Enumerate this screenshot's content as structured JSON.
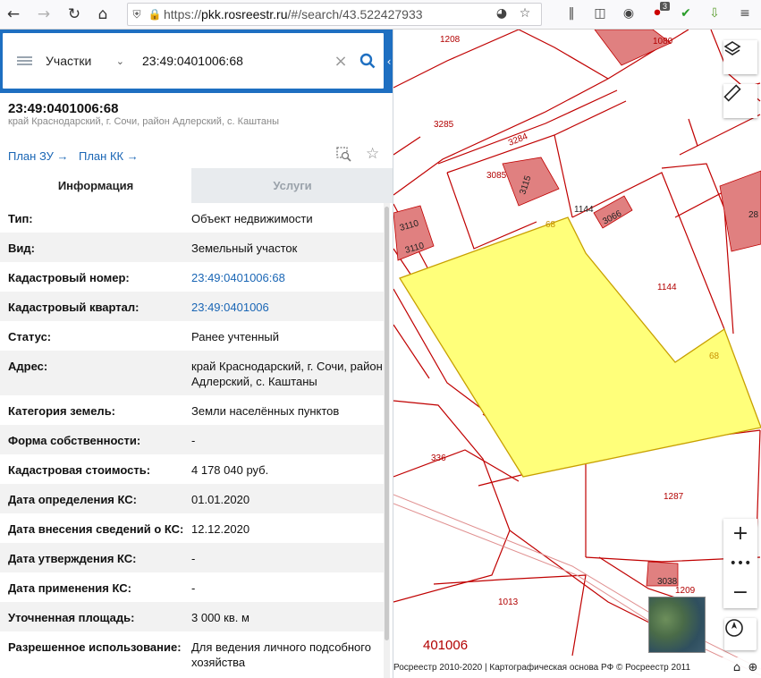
{
  "browser": {
    "url_scheme": "https://",
    "url_host": "pkk.rosreestr.ru",
    "url_path": "/#/search/43.522427933",
    "extension_badge": "3"
  },
  "search": {
    "type_label": "Участки",
    "query": "23:49:0401006:68"
  },
  "object": {
    "title": "23:49:0401006:68",
    "address": "край Краснодарский, г. Сочи, район Адлерский, с. Каштаны",
    "plan_zu": "План ЗУ",
    "plan_kk": "План КК"
  },
  "tabs": {
    "info": "Информация",
    "services": "Услуги"
  },
  "properties": [
    {
      "key": "Тип:",
      "value": "Объект недвижимости",
      "link": false
    },
    {
      "key": "Вид:",
      "value": "Земельный участок",
      "link": false
    },
    {
      "key": "Кадастровый номер:",
      "value": "23:49:0401006:68",
      "link": true
    },
    {
      "key": "Кадастровый квартал:",
      "value": "23:49:0401006",
      "link": true
    },
    {
      "key": "Статус:",
      "value": "Ранее учтенный",
      "link": false
    },
    {
      "key": "Адрес:",
      "value": "край Краснодарский, г. Сочи, район Адлерский, с. Каштаны",
      "link": false
    },
    {
      "key": "Категория земель:",
      "value": "Земли населённых пунктов",
      "link": false
    },
    {
      "key": "Форма собственности:",
      "value": "-",
      "link": false
    },
    {
      "key": "Кадастровая стоимость:",
      "value": "4 178 040 руб.",
      "link": false
    },
    {
      "key": "Дата определения КС:",
      "value": "01.01.2020",
      "link": false
    },
    {
      "key": "Дата внесения сведений о КС:",
      "value": "12.12.2020",
      "link": false
    },
    {
      "key": "Дата утверждения КС:",
      "value": "-",
      "link": false
    },
    {
      "key": "Дата применения КС:",
      "value": "-",
      "link": false
    },
    {
      "key": "Уточненная площадь:",
      "value": "3 000 кв. м",
      "link": false
    },
    {
      "key": "Разрешенное использование:",
      "value": "Для ведения личного подсобного хозяйства",
      "link": false
    }
  ],
  "map": {
    "parcel_labels": [
      "1208",
      "1080",
      "3285",
      "3284",
      "3085",
      "3115",
      "1144",
      "3066",
      "3110",
      "3110",
      "68",
      "1144",
      "68",
      "28",
      "336",
      "1287",
      "1013",
      "3038",
      "1209"
    ],
    "quarter_label": "401006",
    "footer": "Росреестр 2010-2020 | Картографическая основа РФ © Росреестр 2011"
  },
  "colors": {
    "accent": "#1e6fc1",
    "parcel_border": "#c00000",
    "selected_fill": "#ffff7a",
    "building_fill": "#e08080"
  }
}
